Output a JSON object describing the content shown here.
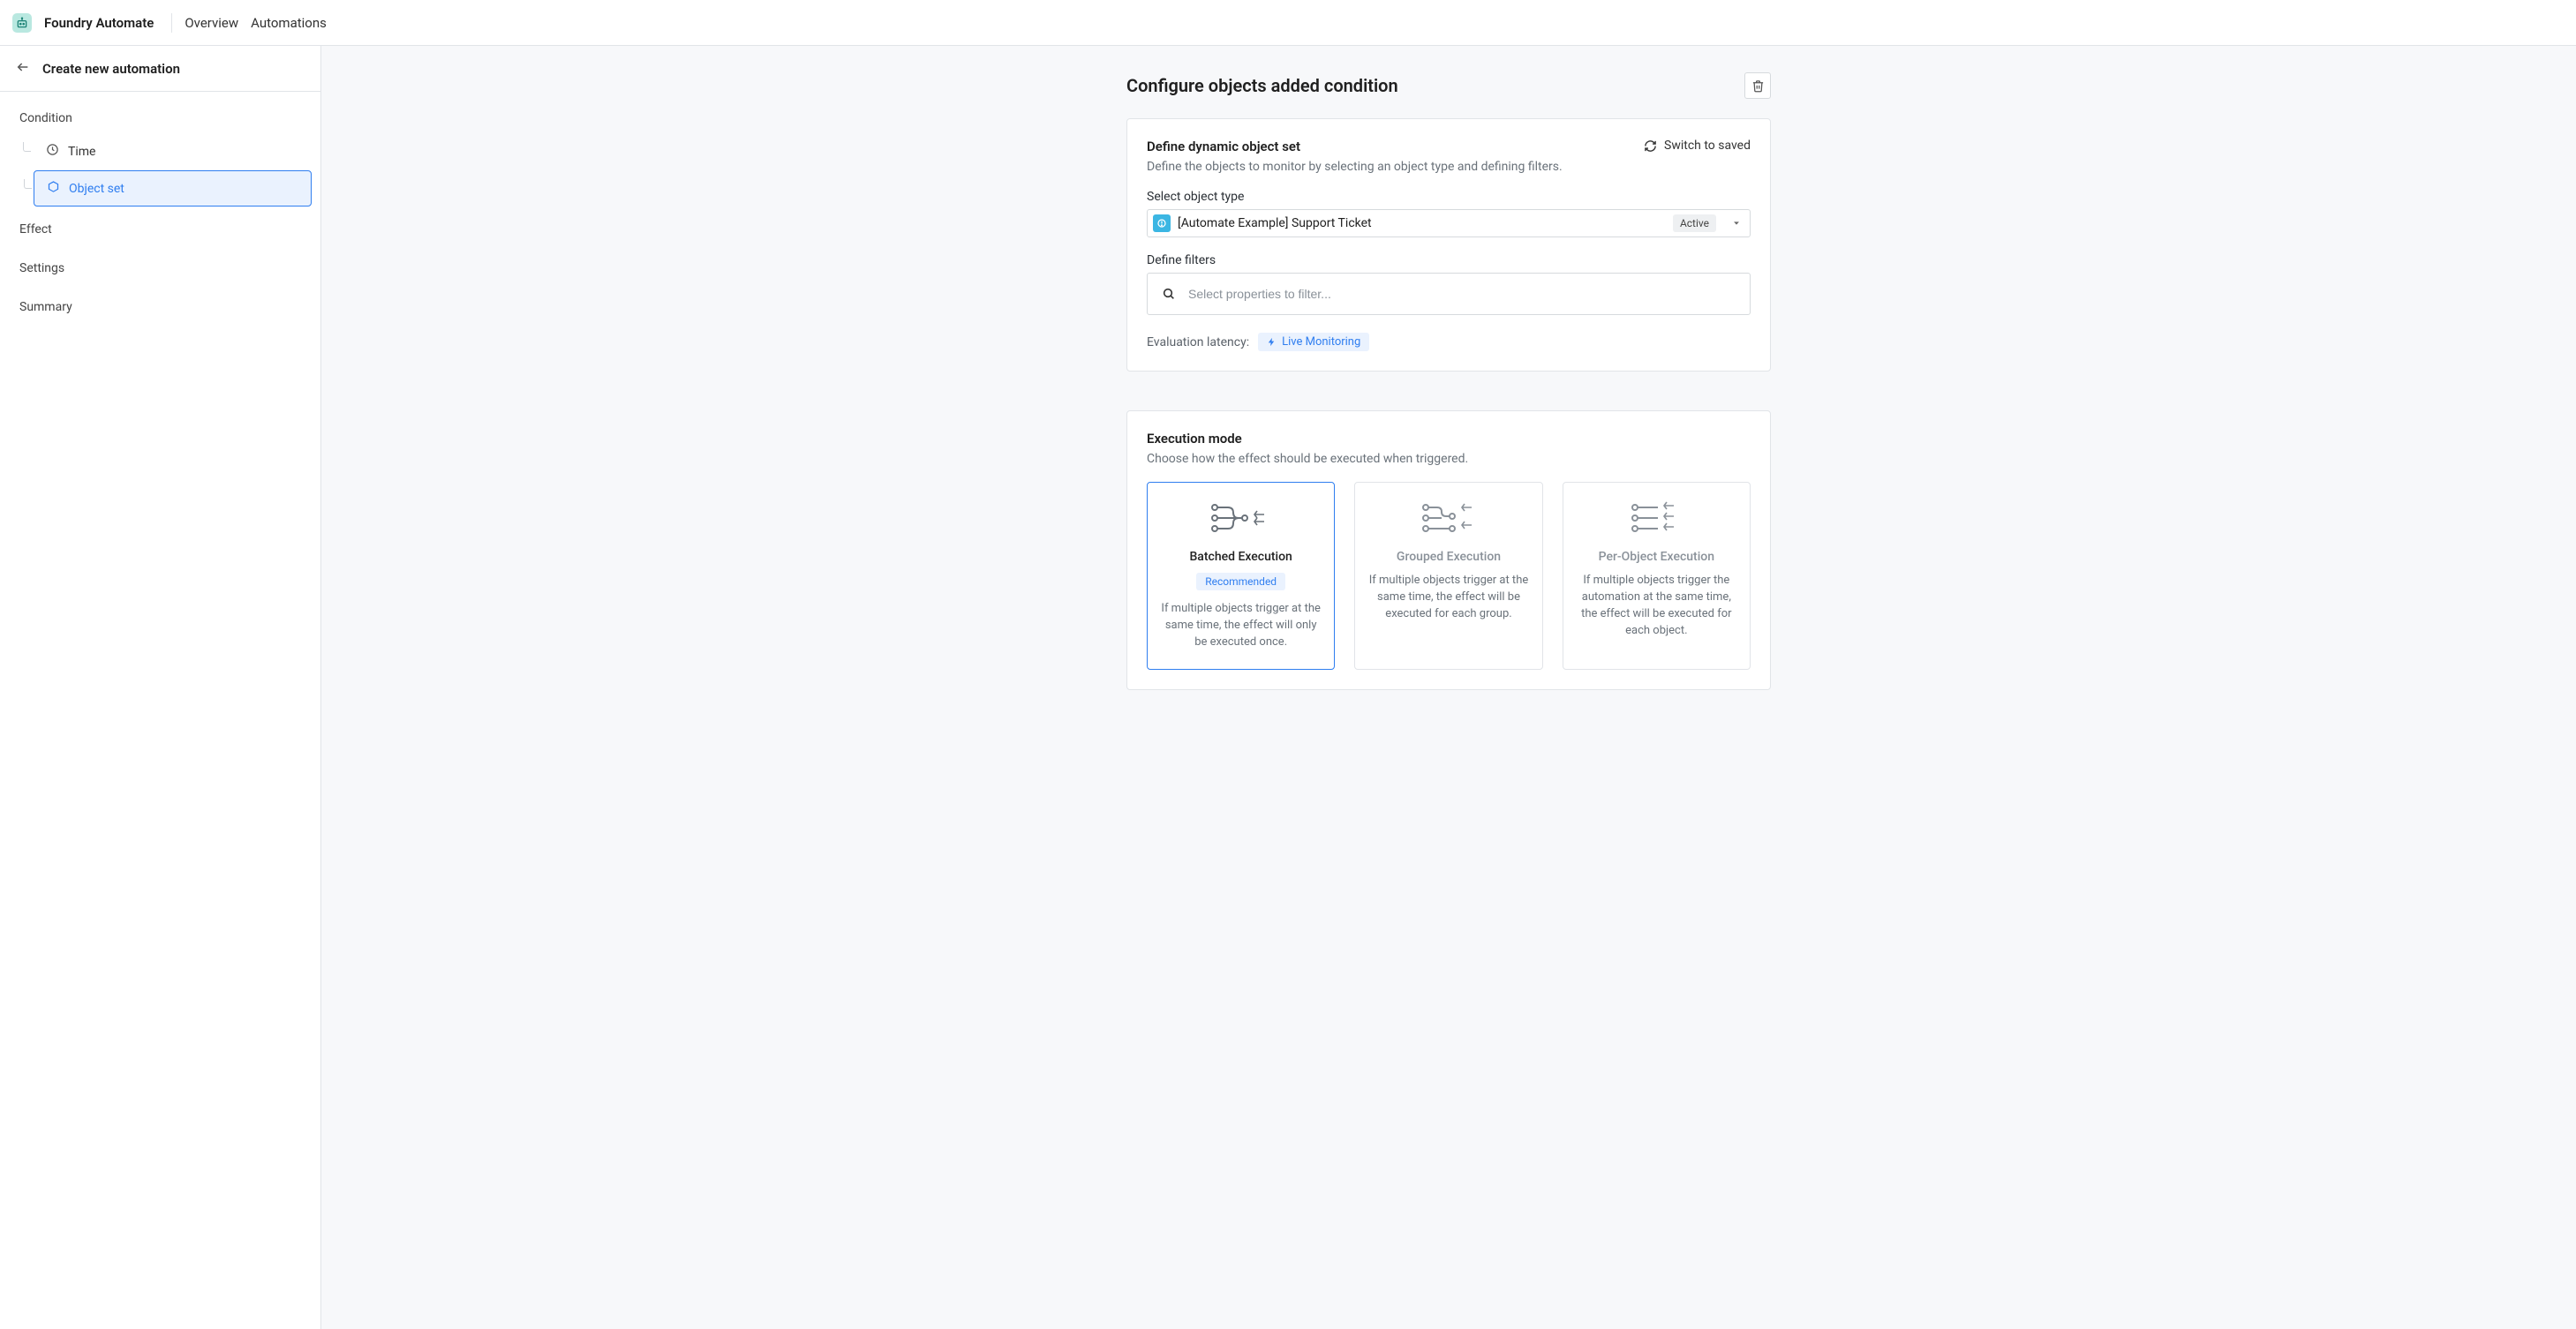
{
  "header": {
    "app_name": "Foundry Automate",
    "nav": {
      "overview": "Overview",
      "automations": "Automations"
    }
  },
  "sidebar": {
    "back_title": "Create new automation",
    "condition_label": "Condition",
    "time_label": "Time",
    "object_set_label": "Object set",
    "effect_label": "Effect",
    "settings_label": "Settings",
    "summary_label": "Summary"
  },
  "main": {
    "title": "Configure objects added condition",
    "object_set_card": {
      "title": "Define dynamic object set",
      "subtitle": "Define the objects to monitor by selecting an object type and defining filters.",
      "switch_label": "Switch to saved",
      "select_object_type_label": "Select object type",
      "object_type_value": "[Automate Example] Support Ticket",
      "object_type_status": "Active",
      "define_filters_label": "Define filters",
      "filter_placeholder": "Select properties to filter...",
      "latency_label": "Evaluation latency:",
      "latency_badge": "Live Monitoring"
    },
    "execution_card": {
      "title": "Execution mode",
      "subtitle": "Choose how the effect should be executed when triggered.",
      "modes": [
        {
          "title": "Batched Execution",
          "recommended": "Recommended",
          "desc": "If multiple objects trigger at the same time, the effect will only be executed once."
        },
        {
          "title": "Grouped Execution",
          "desc": "If multiple objects trigger at the same time, the effect will be executed for each group."
        },
        {
          "title": "Per-Object Execution",
          "desc": "If multiple objects trigger the automation at the same time, the effect will be executed for each object."
        }
      ]
    }
  }
}
